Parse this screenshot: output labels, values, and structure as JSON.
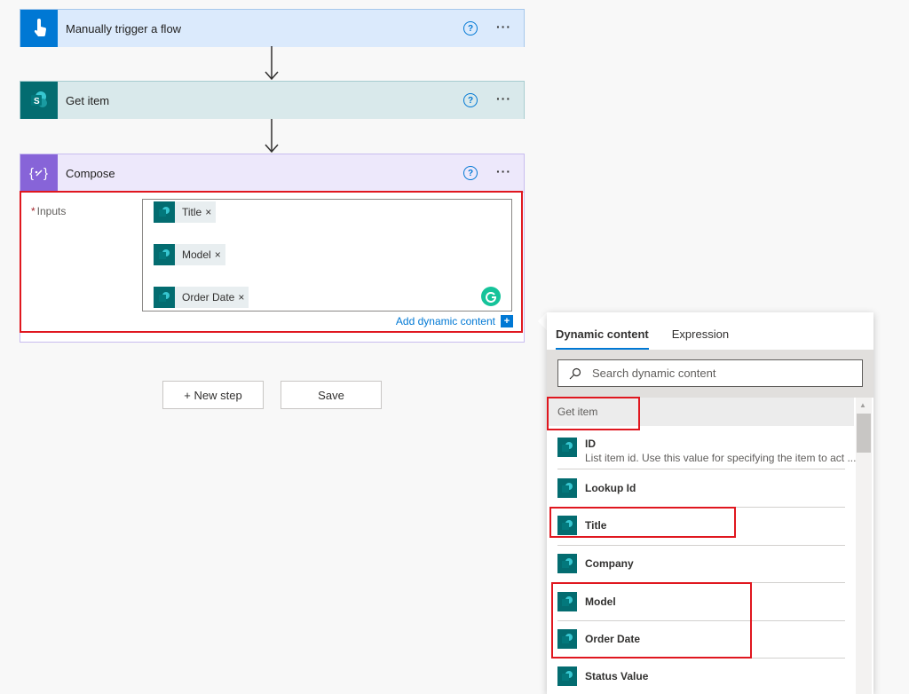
{
  "flow": {
    "trigger": {
      "title": "Manually trigger a flow",
      "help": "?",
      "more": "···",
      "color": "#0078d4"
    },
    "get_item": {
      "title": "Get item",
      "help": "?",
      "more": "···",
      "color": "#036c70",
      "header_bg": "#d9e9eb"
    },
    "compose": {
      "title": "Compose",
      "help": "?",
      "more": "···",
      "color": "#8764d8",
      "header_bg": "#ede8fb",
      "inputs_required_mark": "*",
      "inputs_label": "Inputs",
      "tokens": [
        {
          "label": "Title",
          "remove": "×"
        },
        {
          "label": "Model",
          "remove": "×"
        },
        {
          "label": "Order Date",
          "remove": "×"
        }
      ],
      "add_dynamic": "Add dynamic content",
      "add_dynamic_plus": "+"
    }
  },
  "buttons": {
    "new_step": "+ New step",
    "save": "Save"
  },
  "dynamic_panel": {
    "tabs": [
      {
        "label": "Dynamic content",
        "active": true
      },
      {
        "label": "Expression",
        "active": false
      }
    ],
    "search_placeholder": "Search dynamic content",
    "section": "Get item",
    "items": [
      {
        "title": "ID",
        "desc": "List item id. Use this value for specifying the item to act ..."
      },
      {
        "title": "Lookup Id",
        "desc": ""
      },
      {
        "title": "Title",
        "desc": ""
      },
      {
        "title": "Company",
        "desc": ""
      },
      {
        "title": "Model",
        "desc": ""
      },
      {
        "title": "Order Date",
        "desc": ""
      },
      {
        "title": "Status Value",
        "desc": ""
      }
    ]
  },
  "colors": {
    "highlight": "#e0171f",
    "accent": "#0078d4",
    "sharepoint": "#036c70"
  }
}
